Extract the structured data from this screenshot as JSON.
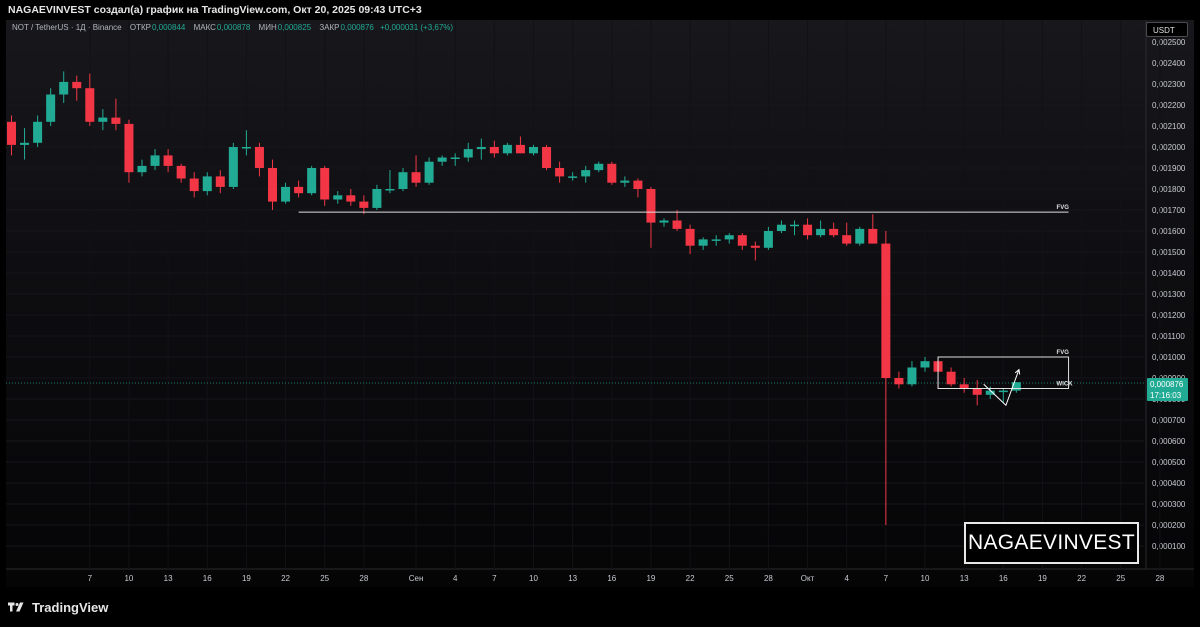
{
  "header": {
    "title": "NAGAEVINVEST создал(а) график на TradingView.com, Окт 20, 2025 09:43 UTC+3"
  },
  "legend": {
    "symbol": "NOT / TetherUS · 1Д · Binance",
    "open_label": "ОТКР",
    "open_value": "0,000844",
    "high_label": "МАКС",
    "high_value": "0,000878",
    "low_label": "МИН",
    "low_value": "0,000825",
    "close_label": "ЗАКР",
    "close_value": "0,000876",
    "change": "+0,000031 (+3,67%)"
  },
  "currency_button": {
    "label": "USDT"
  },
  "last_price": {
    "price": "0,000876",
    "countdown": "17:16:03"
  },
  "watermark": {
    "text": "NAGAEVINVEST"
  },
  "footer": {
    "brand": "TradingView",
    "icon": "tradingview-logo-icon"
  },
  "colors": {
    "up": "#22ab94",
    "down": "#f23645",
    "annotation": "#e0e0e0"
  },
  "annotations": [
    {
      "label": "FVG",
      "type": "line",
      "x_from": "2025-08-23",
      "x_to": "2025-10-21",
      "y": 0.00169
    },
    {
      "label": "FVG",
      "type": "box",
      "x_from": "2025-10-11",
      "x_to": "2025-10-21",
      "y_top": 0.001,
      "y_bottom": 0.00085
    },
    {
      "label": "WICK",
      "type": "line",
      "x_from": "2025-10-11",
      "x_to": "2025-10-21",
      "y": 0.00085
    }
  ],
  "chart_data": {
    "type": "candlestick",
    "x_unit": "date",
    "y_axis": {
      "ticks": [
        "0,002500",
        "0,002400",
        "0,002300",
        "0,002200",
        "0,002100",
        "0,002000",
        "0,001900",
        "0,001800",
        "0,001700",
        "0,001600",
        "0,001500",
        "0,001400",
        "0,001300",
        "0,001200",
        "0,001100",
        "0,001000",
        "0,000900",
        "0,000800",
        "0,000700",
        "0,000600",
        "0,000500",
        "0,000400",
        "0,000300",
        "0,000200",
        "0,000100"
      ],
      "tick_values": [
        0.0025,
        0.0024,
        0.0023,
        0.0022,
        0.0021,
        0.002,
        0.0019,
        0.0018,
        0.0017,
        0.0016,
        0.0015,
        0.0014,
        0.0013,
        0.0012,
        0.0011,
        0.001,
        0.0009,
        0.0008,
        0.0007,
        0.0006,
        0.0005,
        0.0004,
        0.0003,
        0.0002,
        0.0001
      ],
      "range": [
        0.0,
        0.0026
      ]
    },
    "x_axis": {
      "ticks": [
        {
          "label": "7",
          "date": "2025-07-07"
        },
        {
          "label": "10",
          "date": "2025-07-10"
        },
        {
          "label": "13",
          "date": "2025-07-13"
        },
        {
          "label": "16",
          "date": "2025-07-16"
        },
        {
          "label": "19",
          "date": "2025-07-19"
        },
        {
          "label": "22",
          "date": "2025-07-22"
        },
        {
          "label": "25",
          "date": "2025-07-25"
        },
        {
          "label": "28",
          "date": "2025-07-28"
        },
        {
          "label": "Сен",
          "date": "2025-09-01"
        },
        {
          "label": "4",
          "date": "2025-09-04"
        },
        {
          "label": "7",
          "date": "2025-09-07"
        },
        {
          "label": "10",
          "date": "2025-09-10"
        },
        {
          "label": "13",
          "date": "2025-09-13"
        },
        {
          "label": "16",
          "date": "2025-09-16"
        },
        {
          "label": "19",
          "date": "2025-09-19"
        },
        {
          "label": "22",
          "date": "2025-09-22"
        },
        {
          "label": "25",
          "date": "2025-09-25"
        },
        {
          "label": "28",
          "date": "2025-09-28"
        },
        {
          "label": "Окт",
          "date": "2025-10-01"
        },
        {
          "label": "4",
          "date": "2025-10-04"
        },
        {
          "label": "7",
          "date": "2025-10-07"
        },
        {
          "label": "10",
          "date": "2025-10-10"
        },
        {
          "label": "13",
          "date": "2025-10-13"
        },
        {
          "label": "16",
          "date": "2025-10-16"
        },
        {
          "label": "19",
          "date": "2025-10-19"
        },
        {
          "label": "22",
          "date": "2025-10-22"
        },
        {
          "label": "25",
          "date": "2025-10-25"
        },
        {
          "label": "28",
          "date": "2025-10-28"
        }
      ]
    },
    "candles": [
      {
        "o": 0.00212,
        "h": 0.00215,
        "l": 0.00196,
        "c": 0.00201
      },
      {
        "o": 0.00201,
        "h": 0.00209,
        "l": 0.00194,
        "c": 0.00202
      },
      {
        "o": 0.00202,
        "h": 0.00215,
        "l": 0.002,
        "c": 0.00212
      },
      {
        "o": 0.00212,
        "h": 0.00228,
        "l": 0.0021,
        "c": 0.00225
      },
      {
        "o": 0.00225,
        "h": 0.00236,
        "l": 0.00221,
        "c": 0.00231
      },
      {
        "o": 0.00231,
        "h": 0.00234,
        "l": 0.00222,
        "c": 0.00228
      },
      {
        "o": 0.00228,
        "h": 0.00235,
        "l": 0.0021,
        "c": 0.00212
      },
      {
        "o": 0.00212,
        "h": 0.00218,
        "l": 0.00208,
        "c": 0.00214
      },
      {
        "o": 0.00214,
        "h": 0.00223,
        "l": 0.00208,
        "c": 0.00211
      },
      {
        "o": 0.00211,
        "h": 0.00213,
        "l": 0.00183,
        "c": 0.00188
      },
      {
        "o": 0.00188,
        "h": 0.00194,
        "l": 0.00186,
        "c": 0.00191
      },
      {
        "o": 0.00191,
        "h": 0.00199,
        "l": 0.00189,
        "c": 0.00196
      },
      {
        "o": 0.00196,
        "h": 0.00199,
        "l": 0.00188,
        "c": 0.00191
      },
      {
        "o": 0.00191,
        "h": 0.00192,
        "l": 0.00183,
        "c": 0.00185
      },
      {
        "o": 0.00185,
        "h": 0.00188,
        "l": 0.00176,
        "c": 0.00179
      },
      {
        "o": 0.00179,
        "h": 0.00188,
        "l": 0.00177,
        "c": 0.00186
      },
      {
        "o": 0.00186,
        "h": 0.00189,
        "l": 0.00178,
        "c": 0.00181
      },
      {
        "o": 0.00181,
        "h": 0.00202,
        "l": 0.0018,
        "c": 0.002
      },
      {
        "o": 0.002,
        "h": 0.00208,
        "l": 0.00196,
        "c": 0.002
      },
      {
        "o": 0.002,
        "h": 0.00202,
        "l": 0.00186,
        "c": 0.0019
      },
      {
        "o": 0.0019,
        "h": 0.00194,
        "l": 0.0017,
        "c": 0.00174
      },
      {
        "o": 0.00174,
        "h": 0.00183,
        "l": 0.00173,
        "c": 0.00181
      },
      {
        "o": 0.00181,
        "h": 0.00184,
        "l": 0.00176,
        "c": 0.00178
      },
      {
        "o": 0.00178,
        "h": 0.00191,
        "l": 0.00177,
        "c": 0.0019
      },
      {
        "o": 0.0019,
        "h": 0.00191,
        "l": 0.00172,
        "c": 0.00175
      },
      {
        "o": 0.00175,
        "h": 0.00179,
        "l": 0.00173,
        "c": 0.00177
      },
      {
        "o": 0.00177,
        "h": 0.0018,
        "l": 0.00172,
        "c": 0.00174
      },
      {
        "o": 0.00174,
        "h": 0.00177,
        "l": 0.00168,
        "c": 0.00171
      },
      {
        "o": 0.00171,
        "h": 0.00182,
        "l": 0.0017,
        "c": 0.0018
      },
      {
        "o": 0.0018,
        "h": 0.00189,
        "l": 0.00178,
        "c": 0.0018
      },
      {
        "o": 0.0018,
        "h": 0.0019,
        "l": 0.00179,
        "c": 0.00188
      },
      {
        "o": 0.00188,
        "h": 0.00196,
        "l": 0.00181,
        "c": 0.00183
      },
      {
        "o": 0.00183,
        "h": 0.00195,
        "l": 0.00182,
        "c": 0.00193
      },
      {
        "o": 0.00193,
        "h": 0.00196,
        "l": 0.00191,
        "c": 0.00195
      },
      {
        "o": 0.00195,
        "h": 0.00197,
        "l": 0.00191,
        "c": 0.00195
      },
      {
        "o": 0.00195,
        "h": 0.00202,
        "l": 0.00193,
        "c": 0.00199
      },
      {
        "o": 0.00199,
        "h": 0.00204,
        "l": 0.00194,
        "c": 0.002
      },
      {
        "o": 0.002,
        "h": 0.00203,
        "l": 0.00195,
        "c": 0.00197
      },
      {
        "o": 0.00197,
        "h": 0.00202,
        "l": 0.00196,
        "c": 0.00201
      },
      {
        "o": 0.00201,
        "h": 0.00205,
        "l": 0.00197,
        "c": 0.00197
      },
      {
        "o": 0.00197,
        "h": 0.00201,
        "l": 0.00196,
        "c": 0.002
      },
      {
        "o": 0.002,
        "h": 0.00201,
        "l": 0.00189,
        "c": 0.0019
      },
      {
        "o": 0.0019,
        "h": 0.00193,
        "l": 0.00183,
        "c": 0.00186
      },
      {
        "o": 0.00186,
        "h": 0.00188,
        "l": 0.00184,
        "c": 0.00186
      },
      {
        "o": 0.00186,
        "h": 0.00191,
        "l": 0.00183,
        "c": 0.00189
      },
      {
        "o": 0.00189,
        "h": 0.00193,
        "l": 0.00188,
        "c": 0.00192
      },
      {
        "o": 0.00192,
        "h": 0.00193,
        "l": 0.00182,
        "c": 0.00183
      },
      {
        "o": 0.00183,
        "h": 0.00186,
        "l": 0.00181,
        "c": 0.00184
      },
      {
        "o": 0.00184,
        "h": 0.00185,
        "l": 0.00176,
        "c": 0.0018
      },
      {
        "o": 0.0018,
        "h": 0.00181,
        "l": 0.00152,
        "c": 0.00164
      },
      {
        "o": 0.00164,
        "h": 0.00166,
        "l": 0.00162,
        "c": 0.00165
      },
      {
        "o": 0.00165,
        "h": 0.0017,
        "l": 0.0016,
        "c": 0.00161
      },
      {
        "o": 0.00161,
        "h": 0.00163,
        "l": 0.00149,
        "c": 0.00153
      },
      {
        "o": 0.00153,
        "h": 0.00157,
        "l": 0.00151,
        "c": 0.00156
      },
      {
        "o": 0.00156,
        "h": 0.00158,
        "l": 0.00153,
        "c": 0.00156
      },
      {
        "o": 0.00156,
        "h": 0.00159,
        "l": 0.00154,
        "c": 0.00158
      },
      {
        "o": 0.00158,
        "h": 0.00159,
        "l": 0.00151,
        "c": 0.00153
      },
      {
        "o": 0.00153,
        "h": 0.00155,
        "l": 0.00146,
        "c": 0.00152
      },
      {
        "o": 0.00152,
        "h": 0.00162,
        "l": 0.00151,
        "c": 0.0016
      },
      {
        "o": 0.0016,
        "h": 0.00165,
        "l": 0.00159,
        "c": 0.00163
      },
      {
        "o": 0.00163,
        "h": 0.00165,
        "l": 0.00158,
        "c": 0.00163
      },
      {
        "o": 0.00163,
        "h": 0.00166,
        "l": 0.00156,
        "c": 0.00158
      },
      {
        "o": 0.00158,
        "h": 0.00165,
        "l": 0.00157,
        "c": 0.00161
      },
      {
        "o": 0.00161,
        "h": 0.00164,
        "l": 0.00157,
        "c": 0.00158
      },
      {
        "o": 0.00158,
        "h": 0.00164,
        "l": 0.00153,
        "c": 0.00154
      },
      {
        "o": 0.00154,
        "h": 0.00162,
        "l": 0.00153,
        "c": 0.00161
      },
      {
        "o": 0.00161,
        "h": 0.00168,
        "l": 0.00154,
        "c": 0.00154
      },
      {
        "o": 0.00154,
        "h": 0.0016,
        "l": 0.0002,
        "c": 0.0009
      },
      {
        "o": 0.0009,
        "h": 0.00093,
        "l": 0.00085,
        "c": 0.00087
      },
      {
        "o": 0.00087,
        "h": 0.00098,
        "l": 0.00086,
        "c": 0.00095
      },
      {
        "o": 0.00095,
        "h": 0.001,
        "l": 0.00093,
        "c": 0.00098
      },
      {
        "o": 0.00098,
        "h": 0.00099,
        "l": 0.00085,
        "c": 0.00093
      },
      {
        "o": 0.00093,
        "h": 0.00095,
        "l": 0.00086,
        "c": 0.00087
      },
      {
        "o": 0.00087,
        "h": 0.0009,
        "l": 0.00083,
        "c": 0.00085
      },
      {
        "o": 0.00085,
        "h": 0.00089,
        "l": 0.00077,
        "c": 0.00082
      },
      {
        "o": 0.00082,
        "h": 0.00086,
        "l": 0.0008,
        "c": 0.00084
      },
      {
        "o": 0.00084,
        "h": 0.00085,
        "l": 0.00078,
        "c": 0.00084
      },
      {
        "o": 0.00084,
        "h": 0.00088,
        "l": 0.00083,
        "c": 0.00088
      }
    ],
    "projection_path": [
      {
        "index": 74.5,
        "price": 0.00087
      },
      {
        "index": 76.2,
        "price": 0.00077
      },
      {
        "index": 77.2,
        "price": 0.00094
      }
    ]
  }
}
